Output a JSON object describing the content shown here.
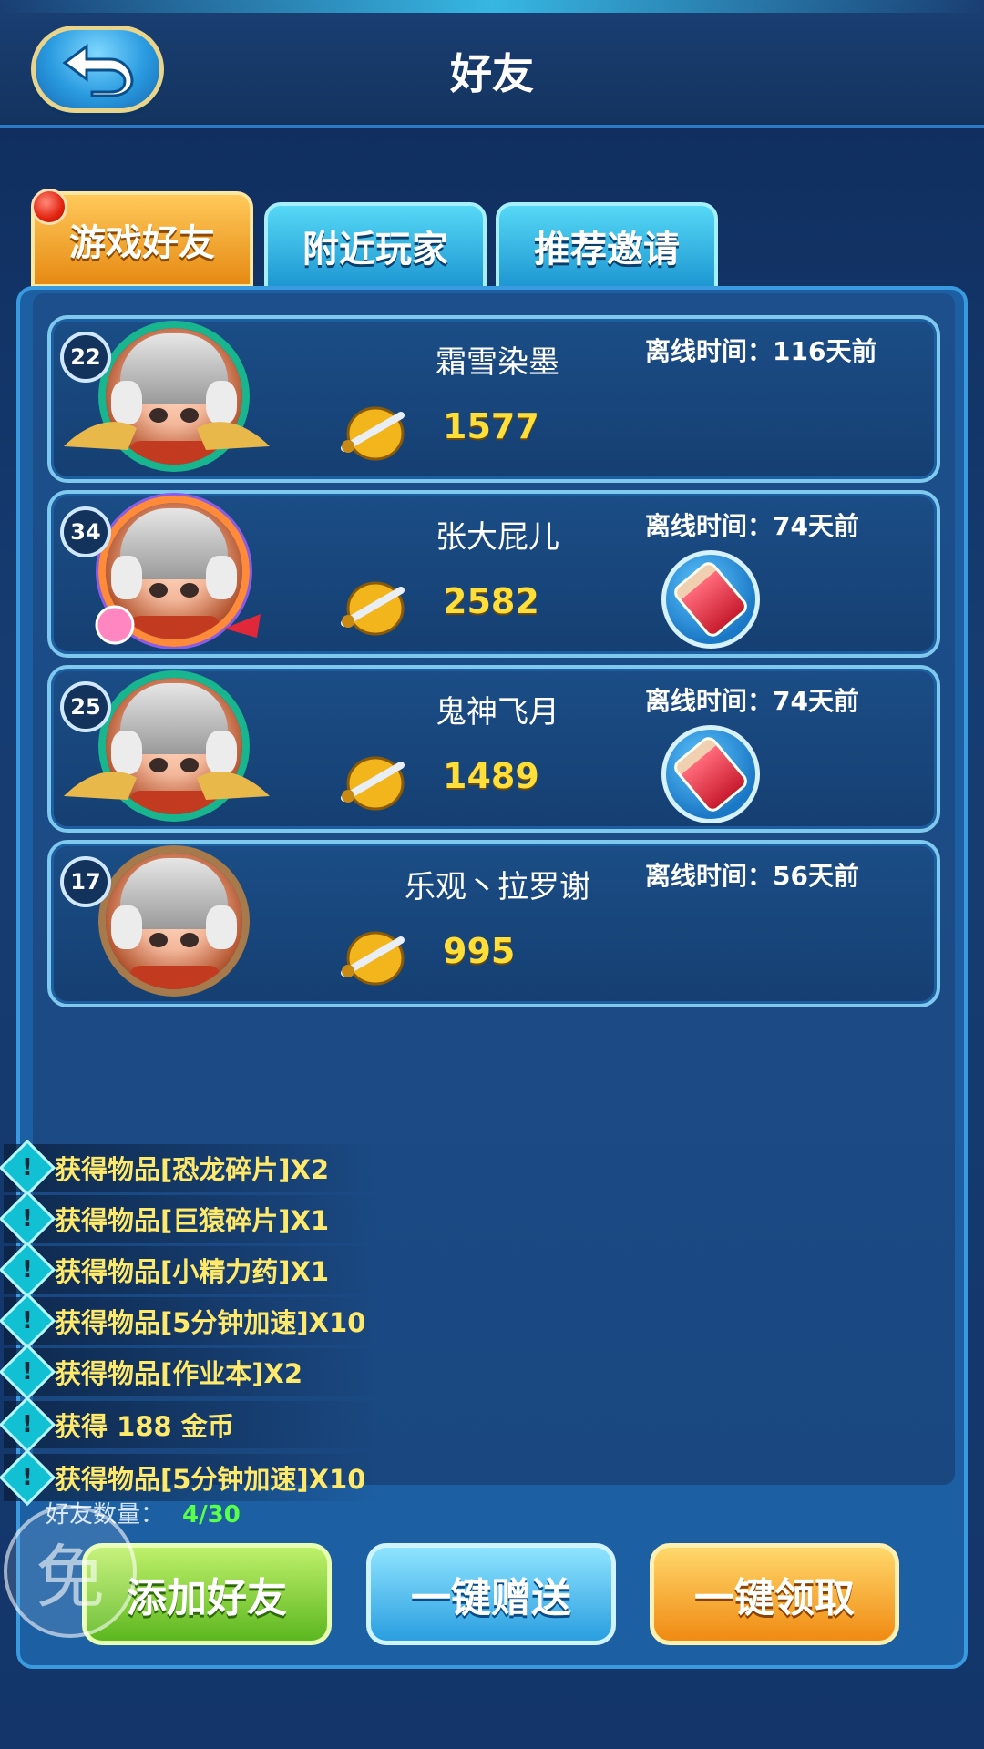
{
  "header": {
    "title": "好友",
    "back_icon": "back-arrow-icon"
  },
  "tabs": [
    {
      "label": "游戏好友",
      "active": true,
      "has_badge": true
    },
    {
      "label": "附近玩家",
      "active": false
    },
    {
      "label": "推荐邀请",
      "active": false
    }
  ],
  "friends": [
    {
      "level": "22",
      "name": "霜雪染墨",
      "offline": "离线时间：116天前",
      "gold": "1577",
      "gift": false,
      "ring": "teal-wings"
    },
    {
      "level": "34",
      "name": "张大屁儿",
      "offline": "离线时间：74天前",
      "gold": "2582",
      "gift": true,
      "ring": "rainbow-candy"
    },
    {
      "level": "25",
      "name": "鬼神飞月",
      "offline": "离线时间：74天前",
      "gold": "1489",
      "gift": true,
      "ring": "teal-wings"
    },
    {
      "level": "17",
      "name": "乐观丶拉罗谢",
      "offline": "离线时间：56天前",
      "gold": "995",
      "gift": false,
      "ring": "bronze"
    }
  ],
  "notifications": [
    "获得物品[恐龙碎片]X2",
    "获得物品[巨猿碎片]X1",
    "获得物品[小精力药]X1",
    "获得物品[5分钟加速]X10",
    "获得物品[作业本]X2",
    "获得 188 金币",
    "获得物品[5分钟加速]X10"
  ],
  "friend_count": {
    "label": "好友数量：",
    "value": "4/30"
  },
  "buttons": {
    "add": "添加好友",
    "send": "一键赠送",
    "receive": "一键领取"
  },
  "watermark": "免",
  "colors": {
    "gold_text": "#ffde3a",
    "notice_text": "#ffe96a",
    "count_value": "#5aff4a",
    "active_tab": "#f0a024"
  }
}
